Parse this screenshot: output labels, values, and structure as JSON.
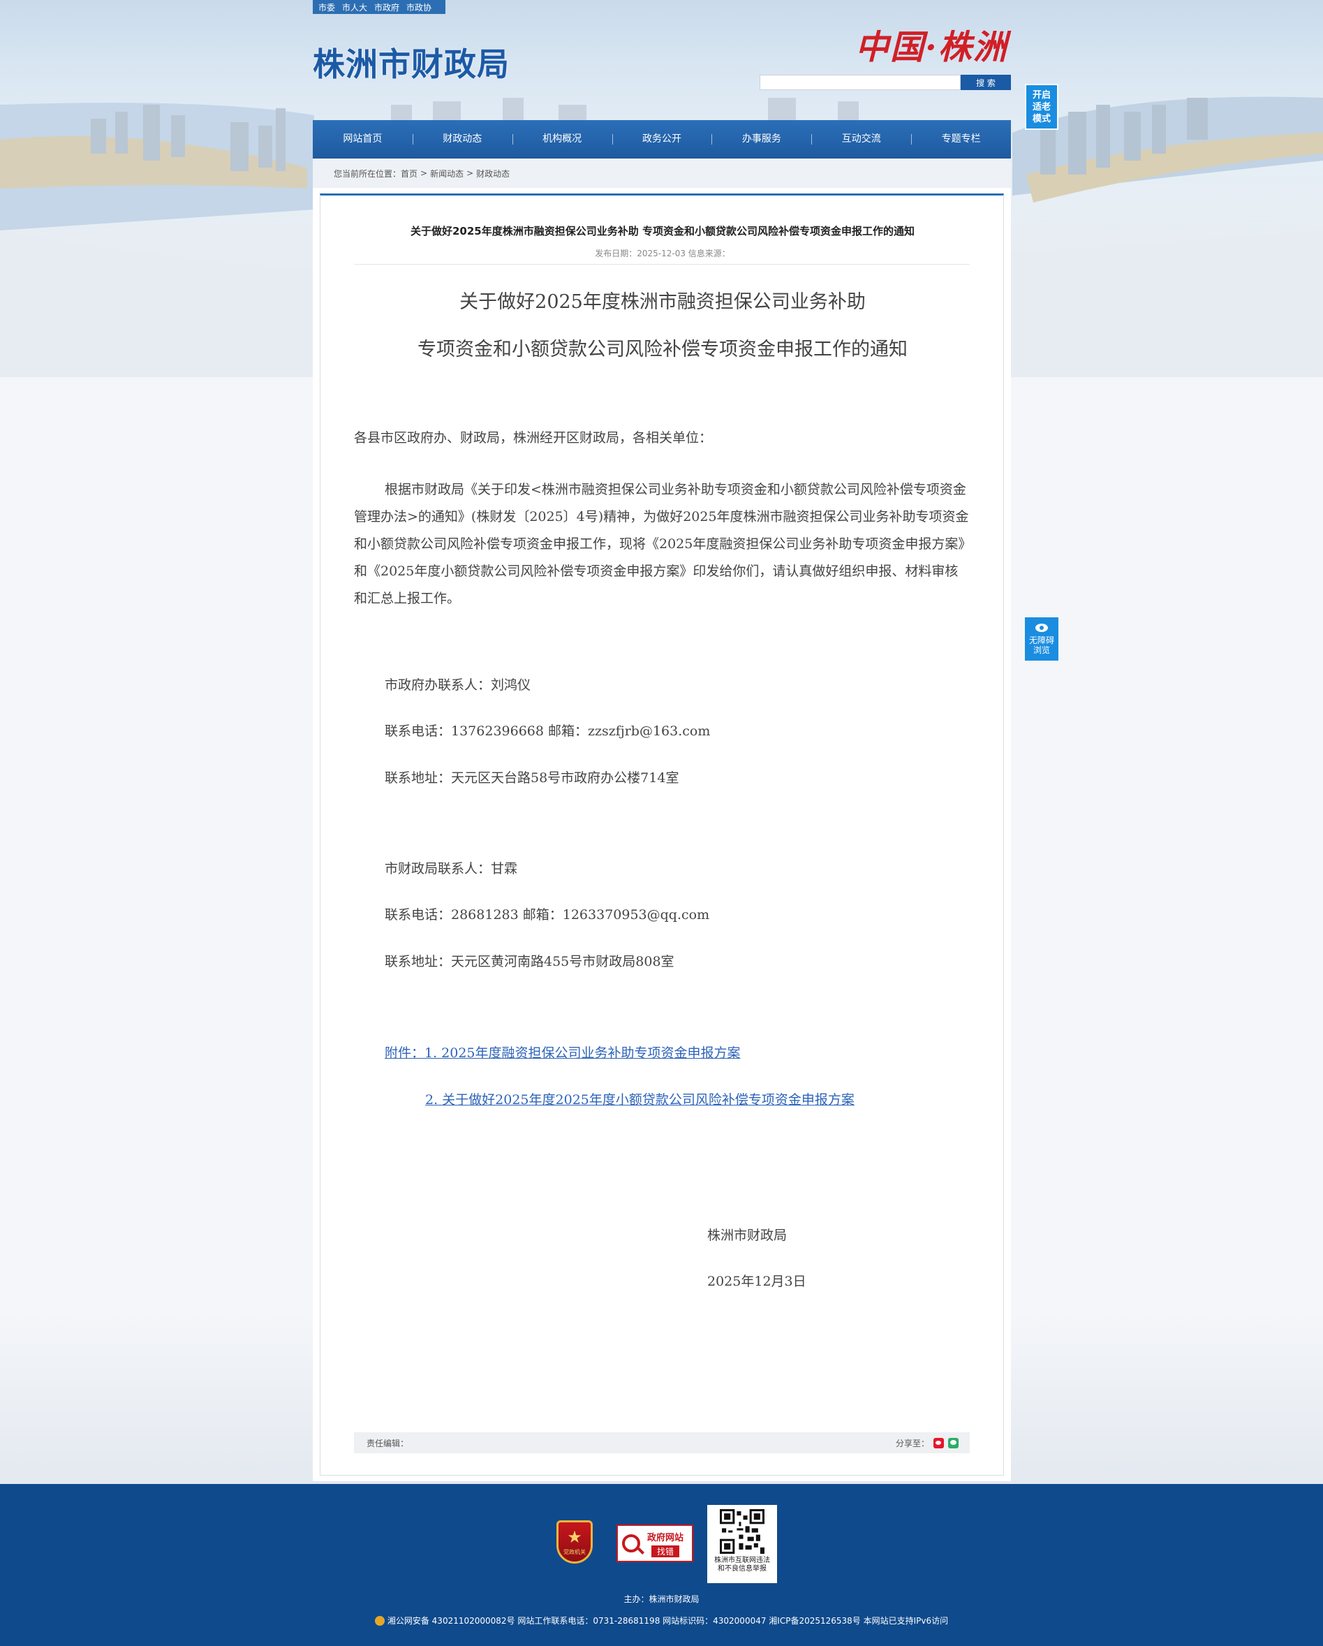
{
  "top_links": [
    "市委",
    "市人大",
    "市政府",
    "市政协"
  ],
  "site_title": "株洲市财政局",
  "brand_logo": "中国·株洲",
  "search": {
    "placeholder": "",
    "button": "搜 索"
  },
  "elder_mode": [
    "开启",
    "适老",
    "模式"
  ],
  "accessible_view": [
    "无障碍",
    "浏览"
  ],
  "nav": [
    "网站首页",
    "财政动态",
    "机构概况",
    "政务公开",
    "办事服务",
    "互动交流",
    "专题专栏"
  ],
  "breadcrumb": {
    "prefix": "您当前所在位置：",
    "items": [
      "首页",
      "新闻动态",
      "财政动态"
    ],
    "sep": ">"
  },
  "article": {
    "head_title": "关于做好2025年度株洲市融资担保公司业务补助   专项资金和小额贷款公司风险补偿专项资金申报工作的通知",
    "meta": "发布日期：2025-12-03    信息来源：",
    "title_line1": "关于做好2025年度株洲市融资担保公司业务补助",
    "title_line2": "专项资金和小额贷款公司风险补偿专项资金申报工作的通知",
    "salutation": "各县市区政府办、财政局，株洲经开区财政局，各相关单位：",
    "body": "根据市财政局《关于印发<株洲市融资担保公司业务补助专项资金和小额贷款公司风险补偿专项资金管理办法>的通知》(株财发〔2025〕4号)精神，为做好2025年度株洲市融资担保公司业务补助专项资金和小额贷款公司风险补偿专项资金申报工作，现将《2025年度融资担保公司业务补助专项资金申报方案》和《2025年度小额贷款公司风险补偿专项资金申报方案》印发给你们，请认真做好组织申报、材料审核和汇总上报工作。",
    "contact1_name": "市政府办联系人：刘鸿仪",
    "contact1_phone": "联系电话：13762396668  邮箱：zzszfjrb@163.com",
    "contact1_addr": "联系地址：天元区天台路58号市政府办公楼714室",
    "contact2_name": "市财政局联系人：甘霖",
    "contact2_phone": "联系电话：28681283      邮箱：1263370953@qq.com",
    "contact2_addr": "联系地址：天元区黄河南路455号市财政局808室",
    "attachment1": "附件：1. 2025年度融资担保公司业务补助专项资金申报方案",
    "attachment2": "2. 关于做好2025年度2025年度小额贷款公司风险补偿专项资金申报方案",
    "sign_org": "株洲市财政局",
    "sign_date": "2025年12月3日",
    "editor": "责任编辑：",
    "share": "分享至："
  },
  "footer": {
    "party_badge": "党政机关",
    "error_badge_line1": "政府网站",
    "error_badge_line2": "找错",
    "qr_caption": "株洲市互联网违法和不良信息举报",
    "host": "主办：株洲市财政局",
    "icp": "湘公网安备 43021102000082号 网站工作联系电话：0731-28681198 网站标识码：4302000047 湘ICP备2025126538号 本网站已支持IPv6访问"
  },
  "colors": {
    "primary": "#1e5aa0",
    "footer": "#0f4a8c",
    "link": "#2d63b9",
    "accent_red": "#d11f26",
    "side_button": "#1a8de0"
  }
}
